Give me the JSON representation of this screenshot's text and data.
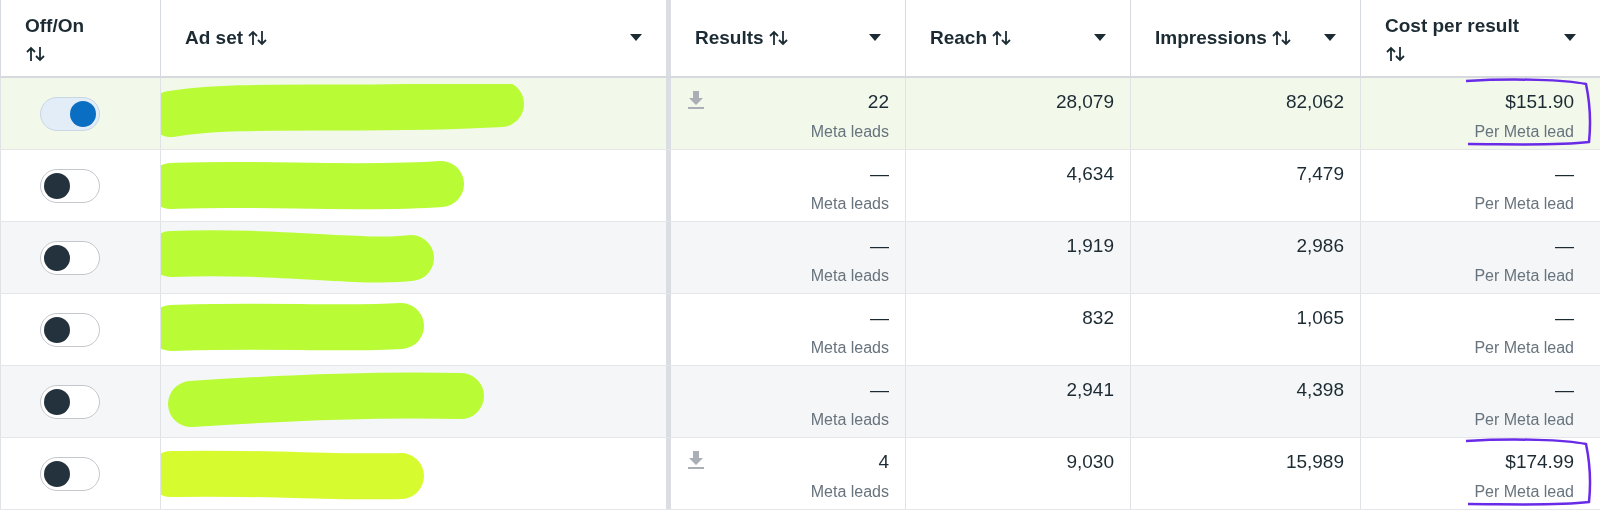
{
  "columns": [
    {
      "label": "Off/On",
      "sortable": true,
      "dropdown": false
    },
    {
      "label": "Ad set",
      "sortable": true,
      "dropdown": true
    },
    {
      "label": "Results",
      "sortable": true,
      "dropdown": true
    },
    {
      "label": "Reach",
      "sortable": true,
      "dropdown": true
    },
    {
      "label": "Impressions",
      "sortable": true,
      "dropdown": true
    },
    {
      "label": "Cost per result",
      "sortable": true,
      "dropdown": true
    }
  ],
  "rows": [
    {
      "on": true,
      "selected": true,
      "download": true,
      "results": "22",
      "results_label": "Meta leads",
      "reach": "28,079",
      "impressions": "82,062",
      "cost": "$151.90",
      "cost_label": "Per Meta lead",
      "annotated": true
    },
    {
      "on": false,
      "selected": false,
      "download": false,
      "results": "—",
      "results_label": "Meta leads",
      "reach": "4,634",
      "impressions": "7,479",
      "cost": "—",
      "cost_label": "Per Meta lead",
      "annotated": false
    },
    {
      "on": false,
      "selected": false,
      "download": false,
      "results": "—",
      "results_label": "Meta leads",
      "reach": "1,919",
      "impressions": "2,986",
      "cost": "—",
      "cost_label": "Per Meta lead",
      "annotated": false
    },
    {
      "on": false,
      "selected": false,
      "download": false,
      "results": "—",
      "results_label": "Meta leads",
      "reach": "832",
      "impressions": "1,065",
      "cost": "—",
      "cost_label": "Per Meta lead",
      "annotated": false
    },
    {
      "on": false,
      "selected": false,
      "download": false,
      "results": "—",
      "results_label": "Meta leads",
      "reach": "2,941",
      "impressions": "4,398",
      "cost": "—",
      "cost_label": "Per Meta lead",
      "annotated": false
    },
    {
      "on": false,
      "selected": false,
      "download": true,
      "results": "4",
      "results_label": "Meta leads",
      "reach": "9,030",
      "impressions": "15,989",
      "cost": "$174.99",
      "cost_label": "Per Meta lead",
      "annotated": true
    }
  ]
}
